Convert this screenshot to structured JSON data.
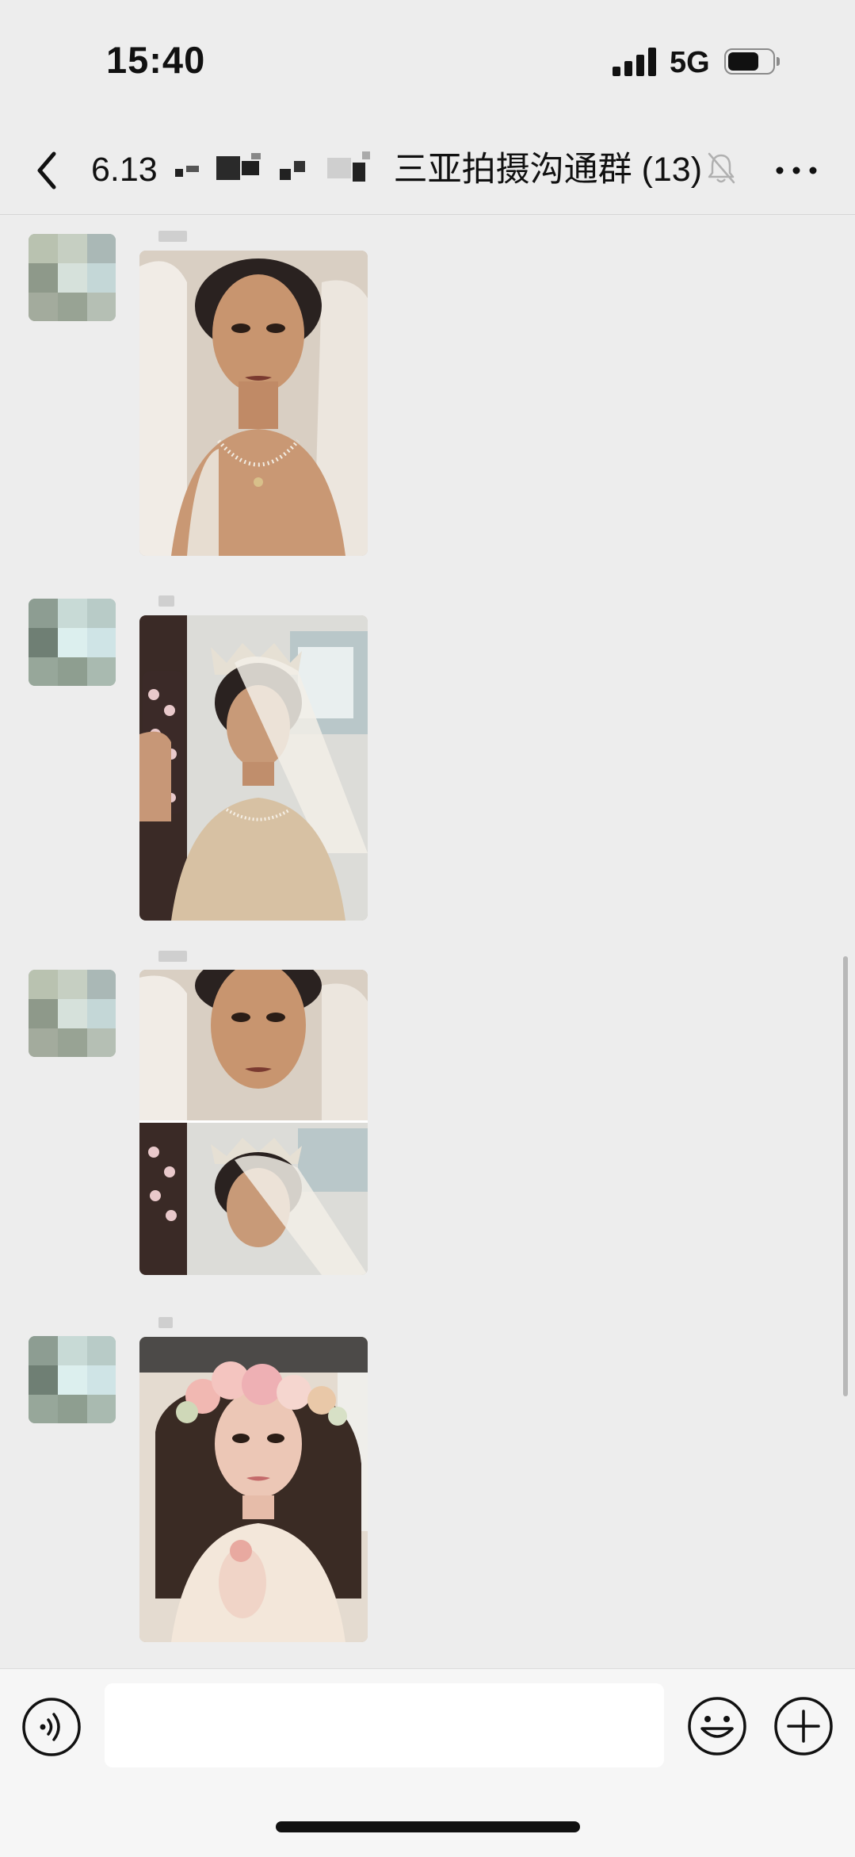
{
  "status_bar": {
    "time": "15:40",
    "network": "5G",
    "icons": [
      "signal-bars-icon",
      "battery-icon"
    ]
  },
  "nav": {
    "title_prefix": "6.13",
    "title_suffix": "三亚拍摄沟通群",
    "member_count": "(13)",
    "icons": [
      "chevron-left-icon",
      "bell-muted-icon",
      "more-dots-icon"
    ]
  },
  "messages": [
    {
      "type": "image",
      "subject": "bride-veil-pearl-necklace"
    },
    {
      "type": "image",
      "subject": "bride-tiara-mirror-selfie"
    },
    {
      "type": "image",
      "subject": "bride-collage-two-looks"
    },
    {
      "type": "image",
      "subject": "bride-flower-crown"
    }
  ],
  "input_bar": {
    "text_value": "",
    "icons": [
      "voice-icon",
      "emoji-icon",
      "plus-icon"
    ]
  },
  "colors": {
    "background": "#ededed",
    "input_bar": "#f6f6f6",
    "text": "#111111"
  }
}
